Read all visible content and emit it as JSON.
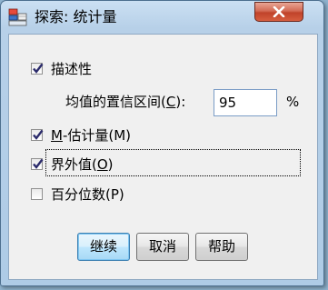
{
  "window": {
    "title": "探索: 统计量",
    "close_icon": "close-icon",
    "app_icon": "spss-app-icon"
  },
  "options": {
    "descriptives": {
      "label": "描述性",
      "checked": true
    },
    "confidence": {
      "label_before": "均值的置信区间(",
      "mnemonic": "C",
      "label_after": "):",
      "value": "95",
      "unit": "%"
    },
    "m_estimators": {
      "mnemonic": "M",
      "label_rest": "-估计量(M)",
      "checked": true
    },
    "outliers": {
      "label_before": "界外值(",
      "mnemonic": "O",
      "label_after": ")",
      "checked": true
    },
    "percentiles": {
      "label": "百分位数(P)",
      "checked": false
    }
  },
  "buttons": {
    "continue": "继续",
    "cancel": "取消",
    "help": "帮助"
  },
  "colors": {
    "title_frame": "#b7d0e8",
    "close_button": "#c7462c",
    "default_button": "#bee6fd"
  }
}
